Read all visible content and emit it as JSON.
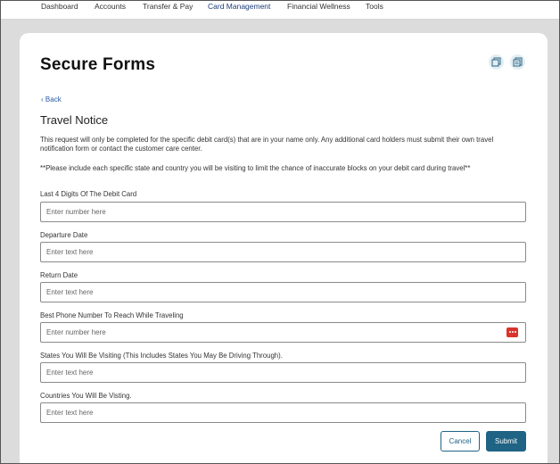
{
  "nav": {
    "items": [
      {
        "label": "Dashboard"
      },
      {
        "label": "Accounts"
      },
      {
        "label": "Transfer & Pay"
      },
      {
        "label": "Card Management"
      },
      {
        "label": "Financial Wellness"
      },
      {
        "label": "Tools"
      }
    ],
    "active": "Card Management"
  },
  "page": {
    "title": "Secure Forms",
    "back_label": "Back",
    "form_title": "Travel Notice",
    "intro": "This request will only be completed for the specific debit card(s) that are in your name only. Any additional card holders must submit their own travel notification form or contact the customer care center.",
    "note": "**Please include each specific state and country you will be visiting to limit the chance of inaccurate blocks on your debit card during travel**"
  },
  "form": {
    "fields": [
      {
        "label": "Last 4 Digits Of The Debit Card",
        "placeholder": "Enter number here",
        "value": ""
      },
      {
        "label": "Departure Date",
        "placeholder": "Enter text here",
        "value": ""
      },
      {
        "label": "Return Date",
        "placeholder": "Enter text here",
        "value": ""
      },
      {
        "label": "Best Phone Number To Reach While Traveling",
        "placeholder": "Enter number here",
        "value": ""
      },
      {
        "label": "States You Will Be Visiting (This Includes States You May Be Driving Through).",
        "placeholder": "Enter text here",
        "value": ""
      },
      {
        "label": "Countries You Will Be Visting.",
        "placeholder": "Enter text here",
        "value": ""
      }
    ],
    "cancel_label": "Cancel",
    "submit_label": "Submit"
  },
  "icons": {
    "header_left": "copy-icon",
    "header_right": "document-icon",
    "phone_field": "password-manager-icon"
  },
  "colors": {
    "accent": "#1f6385",
    "nav_active": "#1c3d7a",
    "link": "#2a5aa8",
    "alert_icon": "#d9342b",
    "background": "#dcdcdc"
  }
}
